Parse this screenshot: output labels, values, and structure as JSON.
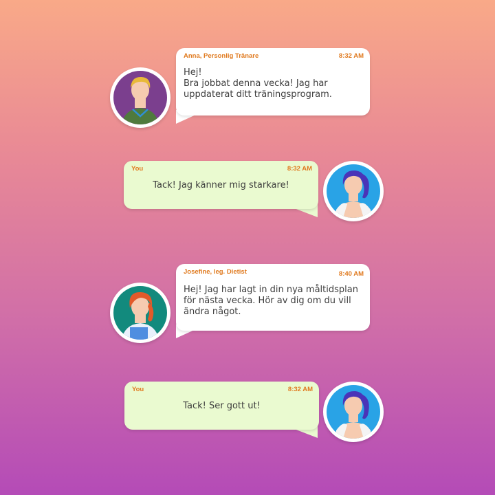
{
  "theme": {
    "name_color": "#e07a1f",
    "incoming_bg": "#ffffff",
    "outgoing_bg": "#eafad0"
  },
  "messages": [
    {
      "sender": "Anna, Personlig Tränare",
      "time": "8:32 AM",
      "text": "Hej!\nBra jobbat denna vecka! Jag har uppdaterat ditt träningsprogram.",
      "avatar": "trainer-avatar-icon"
    },
    {
      "sender": "You",
      "time": "8:32 AM",
      "text": "Tack! Jag känner mig starkare!",
      "avatar": "user-avatar-icon"
    },
    {
      "sender": "Josefine, leg. Dietist",
      "time": "8:40 AM",
      "text": "Hej! Jag har lagt in din nya måltidsplan för nästa vecka. Hör av dig om du vill ändra något.",
      "avatar": "dietitian-avatar-icon"
    },
    {
      "sender": "You",
      "time": "8:32 AM",
      "text": "Tack! Ser gott ut!",
      "avatar": "user-avatar-icon"
    }
  ]
}
